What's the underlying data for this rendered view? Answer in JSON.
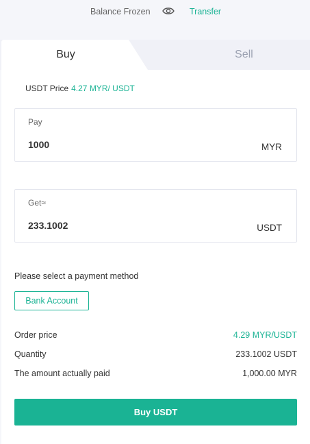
{
  "balance": {
    "label": "Balance Frozen",
    "transfer_label": "Transfer"
  },
  "tabs": {
    "buy": "Buy",
    "sell": "Sell"
  },
  "price": {
    "label": "USDT Price",
    "value": "4.27 MYR/ USDT"
  },
  "pay": {
    "label": "Pay",
    "value": "1000",
    "unit": "MYR"
  },
  "get": {
    "label": "Get≈",
    "value": "233.1002",
    "unit": "USDT"
  },
  "payment": {
    "prompt": "Please select a payment method",
    "method": "Bank Account"
  },
  "summary": {
    "order_price_label": "Order price",
    "order_price_value": "4.29 MYR/USDT",
    "quantity_label": "Quantity",
    "quantity_value": "233.1002 USDT",
    "paid_label": "The amount actually paid",
    "paid_value": "1,000.00 MYR"
  },
  "action": {
    "buy_label": "Buy USDT"
  },
  "colors": {
    "accent": "#1ab394",
    "tab_inactive_bg": "#f0f1f7",
    "muted_text": "#9aa0b0"
  },
  "icons": {
    "visibility": "eye-icon"
  }
}
